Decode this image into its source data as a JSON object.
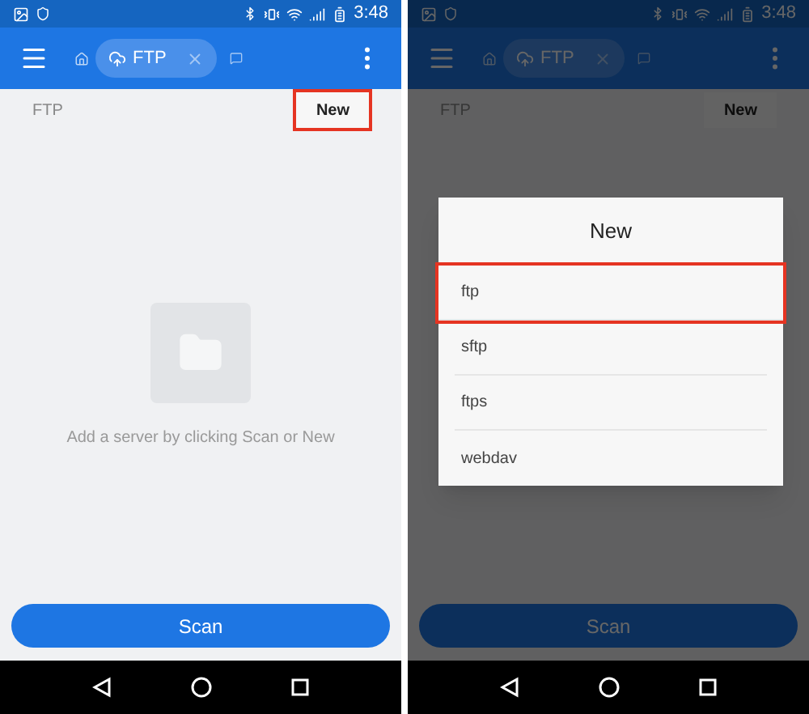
{
  "screens": [
    {
      "dimmed": false,
      "status_bar": {
        "time": "3:48"
      },
      "tab": {
        "label": "FTP"
      },
      "path_label": "FTP",
      "new_button": {
        "label": "New",
        "highlighted": true
      },
      "empty_state": {
        "message": "Add a server by clicking Scan or New"
      },
      "scan_button": {
        "label": "Scan"
      }
    },
    {
      "dimmed": true,
      "status_bar": {
        "time": "3:48"
      },
      "tab": {
        "label": "FTP"
      },
      "path_label": "FTP",
      "new_button": {
        "label": "New",
        "highlighted": false
      },
      "scan_button": {
        "label": "Scan"
      },
      "dialog": {
        "title": "New",
        "items": [
          {
            "label": "ftp",
            "highlighted": true
          },
          {
            "label": "sftp",
            "highlighted": false
          },
          {
            "label": "ftps",
            "highlighted": false
          },
          {
            "label": "webdav",
            "highlighted": false
          }
        ]
      }
    }
  ]
}
